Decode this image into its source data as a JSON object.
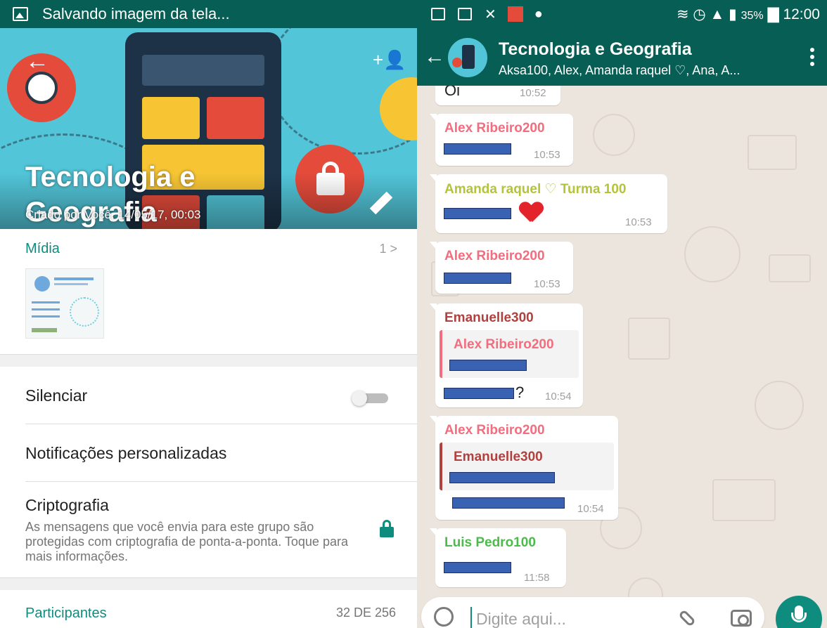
{
  "left": {
    "status_text": "Salvando imagem da tela...",
    "group_title_line1": "Tecnologia e",
    "group_title_line2": "Geografia",
    "created": "Criado por Você, 14/05/17, 00:03",
    "media": {
      "label": "Mídia",
      "count": "1 >"
    },
    "mute_label": "Silenciar",
    "mute_on": false,
    "custom_notifications_label": "Notificações personalizadas",
    "crypto": {
      "title": "Criptografia",
      "description": "As mensagens que você envia para este grupo são protegidas com criptografia de ponta-a-ponta. Toque para mais informações."
    },
    "participants": {
      "label": "Participantes",
      "count": "32 DE 256"
    }
  },
  "right": {
    "status": {
      "battery": "35%",
      "time": "12:00"
    },
    "chat": {
      "name": "Tecnologia e Geografia",
      "members": "Aksa100, Alex, Amanda raquel ♡, Ana, A..."
    },
    "messages": [
      {
        "sender": "",
        "time": "10:52",
        "text_fragment": "Oi"
      },
      {
        "sender": "Alex Ribeiro200",
        "time": "10:53"
      },
      {
        "sender": "Amanda raquel ♡ Turma 100",
        "time": "10:53"
      },
      {
        "sender": "Alex Ribeiro200",
        "time": "10:53"
      },
      {
        "sender": "Emanuelle300",
        "quote_sender": "Alex Ribeiro200",
        "time": "10:54",
        "text_fragment": "?"
      },
      {
        "sender": "Alex Ribeiro200",
        "quote_sender": "Emanuelle300",
        "time": "10:54"
      },
      {
        "sender": "Luis Pedro100",
        "time": "11:58"
      }
    ],
    "input_placeholder": "Digite aqui..."
  },
  "colors": {
    "header": "#075e54",
    "accent": "#0e8c7d",
    "sender_alex": "#f26d7d",
    "sender_amanda": "#b5c33a",
    "sender_emanuelle": "#b0413e",
    "sender_luis": "#4cbb4c"
  }
}
